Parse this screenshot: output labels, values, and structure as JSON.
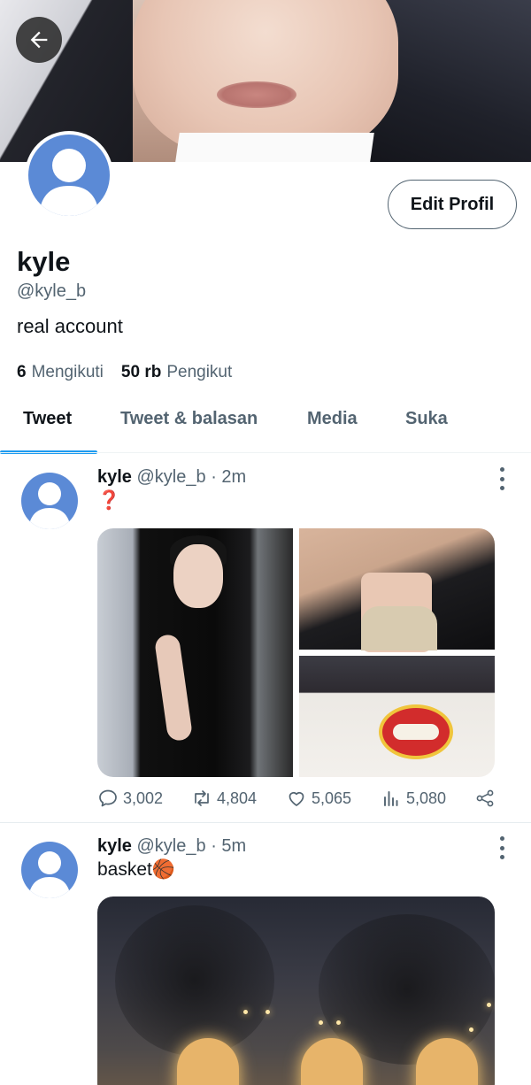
{
  "header": {
    "back_icon": "arrow-left-icon",
    "edit_profile_label": "Edit Profil"
  },
  "profile": {
    "name": "kyle",
    "handle": "@kyle_b",
    "bio": "real account",
    "following_count": "6",
    "following_label": "Mengikuti",
    "followers_count": "50 rb",
    "followers_label": "Pengikut"
  },
  "tabs": [
    {
      "label": "Tweet",
      "active": true
    },
    {
      "label": "Tweet & balasan",
      "active": false
    },
    {
      "label": "Media",
      "active": false
    },
    {
      "label": "Suka",
      "active": false
    }
  ],
  "tweets": [
    {
      "name": "kyle",
      "handle": "@kyle_b",
      "time": "· 2m",
      "text": "❓",
      "replies": "3,002",
      "retweets": "4,804",
      "likes": "5,065",
      "views": "5,080"
    },
    {
      "name": "kyle",
      "handle": "@kyle_b",
      "time": "· 5m",
      "text": "basket🏀"
    }
  ],
  "colors": {
    "accent": "#1d9bf0",
    "text_primary": "#0f1419",
    "text_secondary": "#536471",
    "avatar": "#5b8ad6"
  }
}
